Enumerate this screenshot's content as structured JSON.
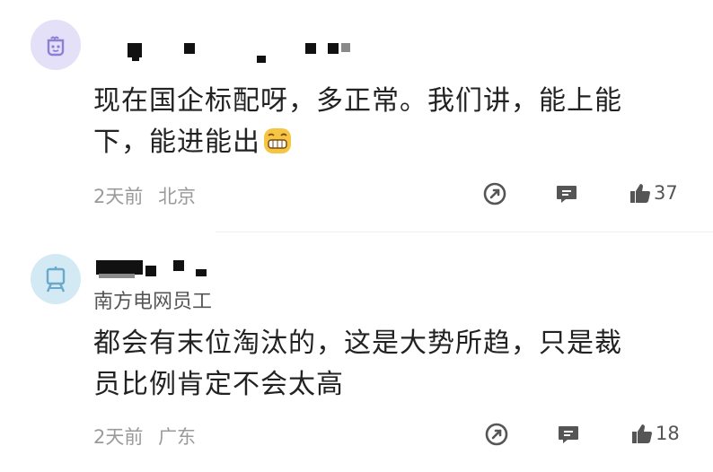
{
  "comments": [
    {
      "text_line1": "现在国企标配呀，多正常。我们讲，能上能",
      "text_line2": "下，能进能出",
      "emoji": "grin-emoji",
      "time": "2天前",
      "location": "北京",
      "likes": "37"
    },
    {
      "subtitle": "南方电网员工",
      "text_line1": "都会有末位淘汰的，这是大势所趋，只是裁",
      "text_line2": "员比例肯定不会太高",
      "time": "2天前",
      "location": "广东",
      "likes": "18"
    }
  ],
  "icons": {
    "share": "share-icon",
    "reply": "comment-icon",
    "like": "thumbs-up-icon"
  },
  "colors": {
    "avatar1_bg": "#e3e0f7",
    "avatar1_fg": "#8b7fd6",
    "avatar2_bg": "#d3e9f4",
    "avatar2_fg": "#6aa9cc",
    "meta_text": "#9a9a9a"
  }
}
